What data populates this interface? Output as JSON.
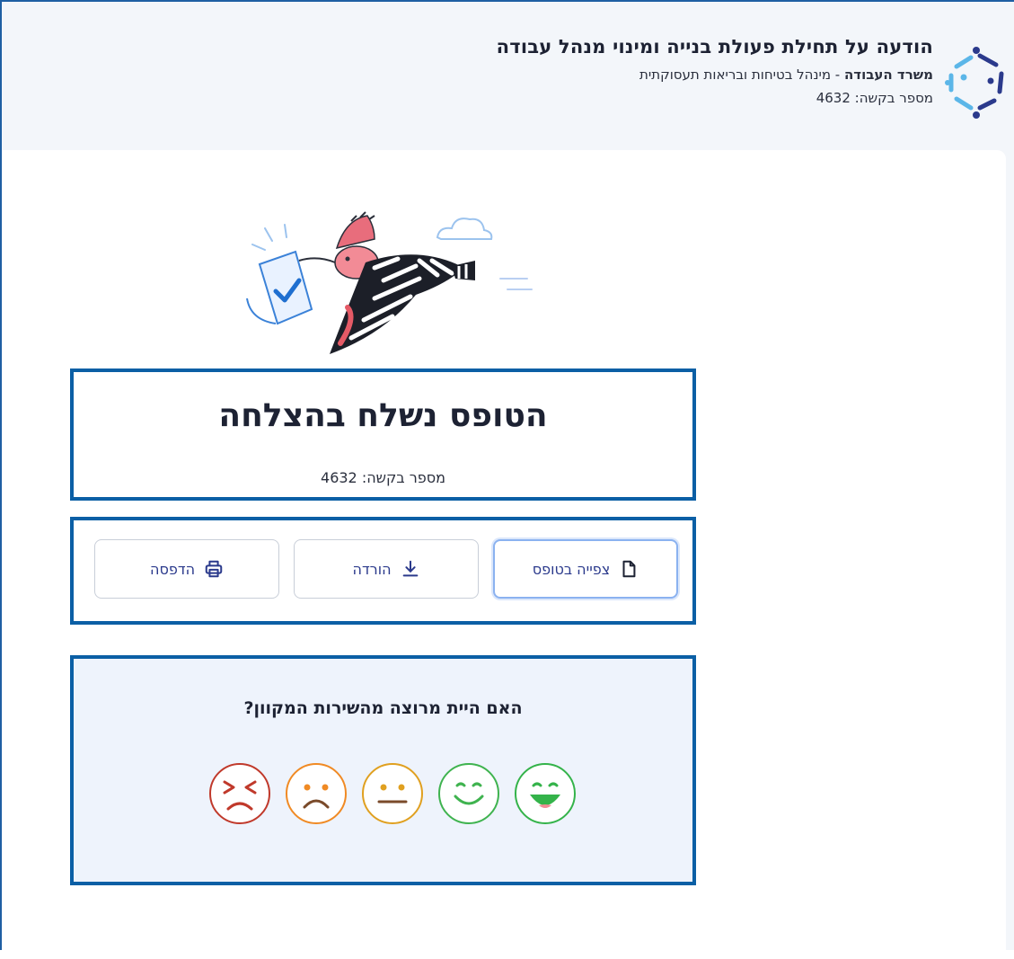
{
  "header": {
    "title": "הודעה על תחילת פעולת בנייה ומינוי מנהל עבודה",
    "ministry": "משרד העבודה",
    "department_sep": " - ",
    "department": "מינהל בטיחות ובריאות תעסוקתית",
    "request_line": "מספר בקשה: 4632"
  },
  "success": {
    "title": "הטופס נשלח בהצלחה",
    "request_line": "מספר בקשה: 4632"
  },
  "actions": {
    "view_label": "צפייה בטופס",
    "download_label": "הורדה",
    "print_label": "הדפסה"
  },
  "feedback": {
    "question": "האם היית מרוצה מהשירות המקוון?",
    "ratings": [
      "very-satisfied",
      "satisfied",
      "neutral",
      "dissatisfied",
      "very-dissatisfied"
    ]
  },
  "colors": {
    "accent": "#0b5fa5",
    "button_text": "#2b3a8c",
    "very_satisfied": "#34b34a",
    "satisfied": "#3fb34f",
    "neutral": "#e0a020",
    "dissatisfied": "#f08a24",
    "very_dissatisfied": "#c0392b"
  }
}
